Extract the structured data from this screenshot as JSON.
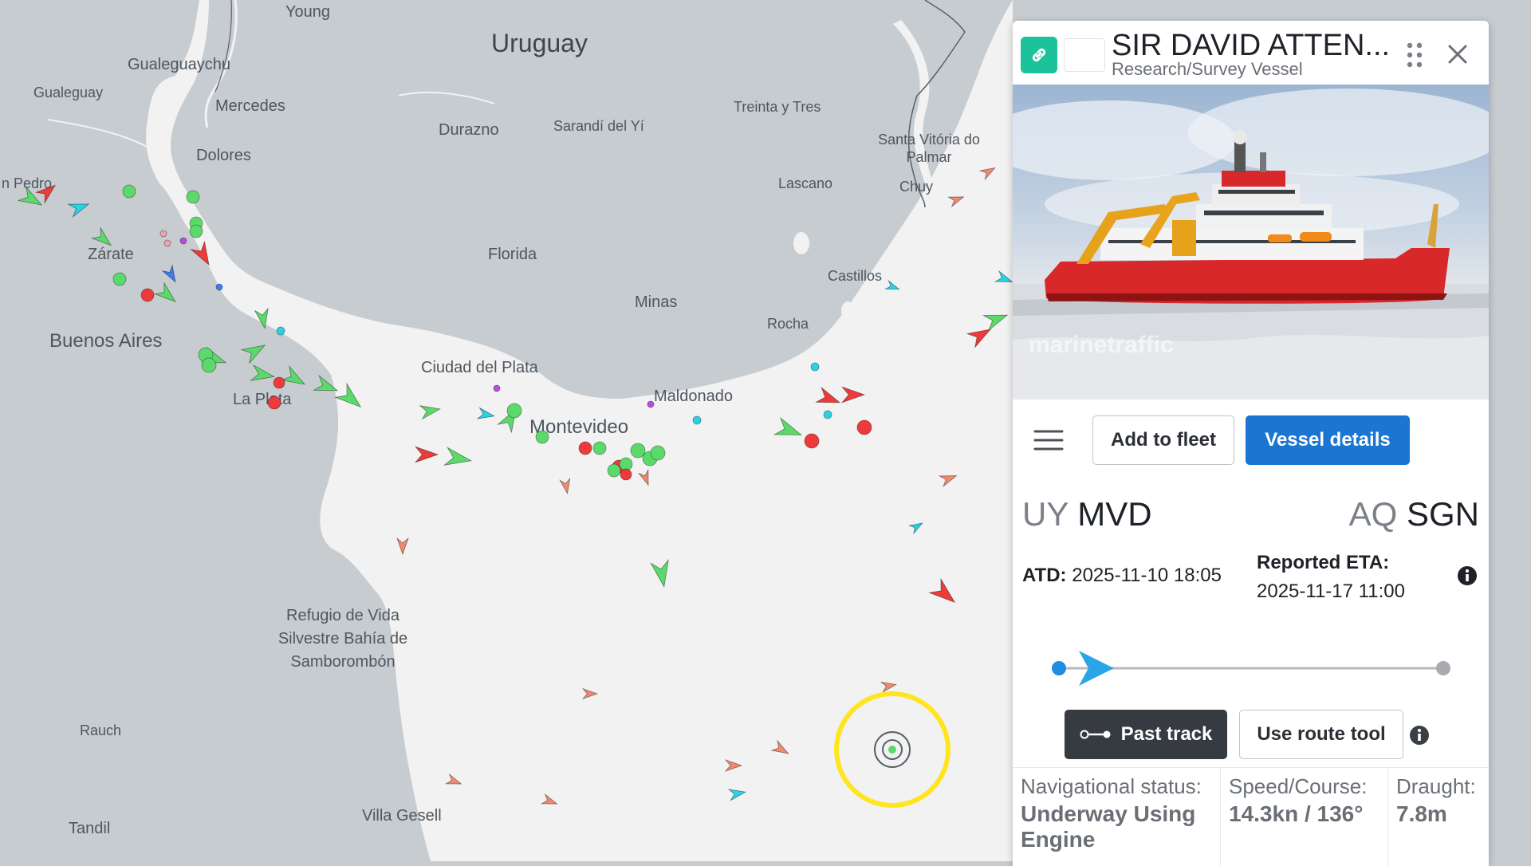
{
  "map": {
    "places": [
      {
        "id": "uruguay",
        "label": "Uruguay"
      },
      {
        "id": "young",
        "label": "Young"
      },
      {
        "id": "gualeguaychu",
        "label": "Gualeguaychu"
      },
      {
        "id": "gualeguay",
        "label": "Gualeguay"
      },
      {
        "id": "mercedes",
        "label": "Mercedes"
      },
      {
        "id": "durazno",
        "label": "Durazno"
      },
      {
        "id": "sarandi",
        "label": "Sarandí del Yí"
      },
      {
        "id": "treinta",
        "label": "Treinta y Tres"
      },
      {
        "id": "santa-vitoria",
        "label": "Santa Vitória do Palmar"
      },
      {
        "id": "dolores",
        "label": "Dolores"
      },
      {
        "id": "san-pedro",
        "label": "n Pedro"
      },
      {
        "id": "chuy",
        "label": "Chuy"
      },
      {
        "id": "lascano",
        "label": "Lascano"
      },
      {
        "id": "zarate",
        "label": "Zárate"
      },
      {
        "id": "florida",
        "label": "Florida"
      },
      {
        "id": "castillos",
        "label": "Castillos"
      },
      {
        "id": "minas",
        "label": "Minas"
      },
      {
        "id": "rocha",
        "label": "Rocha"
      },
      {
        "id": "buenos-aires",
        "label": "Buenos Aires"
      },
      {
        "id": "ciudad-del-plata",
        "label": "Ciudad del Plata"
      },
      {
        "id": "maldonado",
        "label": "Maldonado"
      },
      {
        "id": "la-plata",
        "label": "La Plata"
      },
      {
        "id": "montevideo",
        "label": "Montevideo"
      },
      {
        "id": "refugio",
        "label": "Refugio de Vida Silvestre Bahía de Samborombón"
      },
      {
        "id": "rauch",
        "label": "Rauch"
      },
      {
        "id": "villa-gesell",
        "label": "Villa Gesell"
      },
      {
        "id": "tandil",
        "label": "Tandil"
      }
    ]
  },
  "panel": {
    "vessel_name": "SIR DAVID ATTEN...",
    "vessel_type": "Research/Survey Vessel",
    "photo_watermark": "marinetraffic",
    "add_to_fleet": "Add to fleet",
    "vessel_details": "Vessel details",
    "departure": {
      "country": "UY",
      "port": "MVD"
    },
    "arrival": {
      "country": "AQ",
      "port": "SGN"
    },
    "atd_label": "ATD:",
    "atd_value": "2025-11-10 18:05",
    "eta_label": "Reported ETA:",
    "eta_value": "2025-11-17 11:00",
    "voyage_progress": 0.06,
    "past_track": "Past track",
    "use_route_tool": "Use route tool",
    "stats": [
      {
        "label": "Navigational status:",
        "value": "Underway Using Engine"
      },
      {
        "label": "Speed/Course:",
        "value": "14.3kn / 136°"
      },
      {
        "label": "Draught:",
        "value": "7.8m"
      }
    ]
  },
  "colors": {
    "land": "#c7ccd1",
    "water": "#f2f2f2",
    "cargo": "#5bd96a",
    "tanker": "#ee3a3a",
    "passenger": "#3d7df0",
    "highspeed": "#ffe51f",
    "unknown": "#28d2e4",
    "accent_blue": "#1a76d2",
    "link_green": "#1bc29a"
  }
}
